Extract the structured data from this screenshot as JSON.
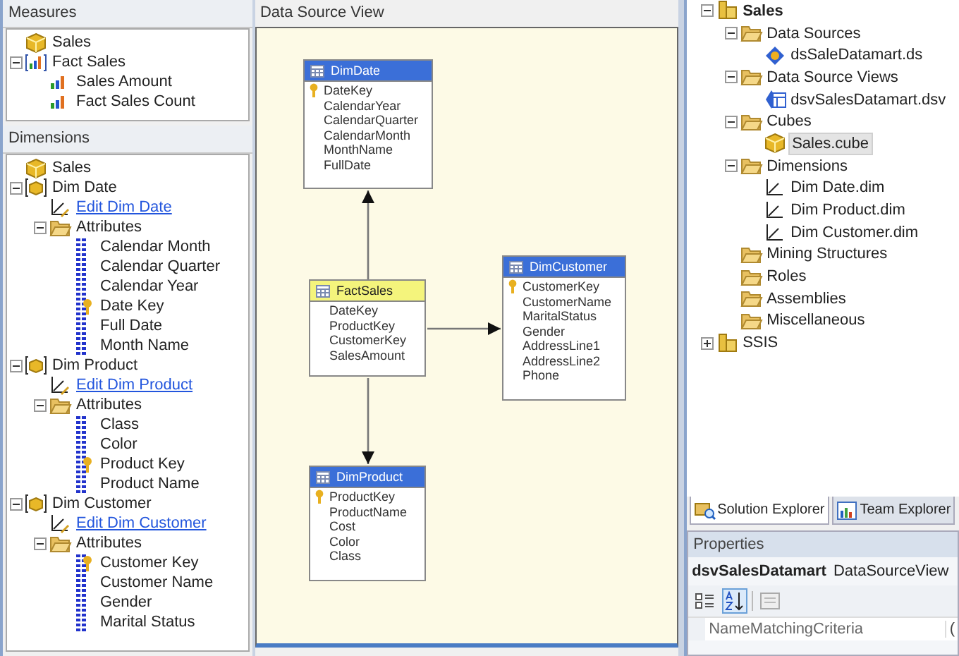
{
  "measures": {
    "title": "Measures",
    "tree": [
      {
        "label": "Sales",
        "kind": "cube"
      },
      {
        "label": "Fact Sales",
        "kind": "measure-group",
        "expanded": true,
        "children": [
          {
            "label": "Sales Amount",
            "kind": "measure"
          },
          {
            "label": "Fact Sales Count",
            "kind": "measure"
          }
        ]
      }
    ]
  },
  "dimensions": {
    "title": "Dimensions",
    "tree": [
      {
        "label": "Sales",
        "kind": "cube"
      },
      {
        "label": "Dim Date",
        "kind": "dimension",
        "expanded": true,
        "children": [
          {
            "label": "Edit Dim Date",
            "kind": "edit-link"
          },
          {
            "label": "Attributes",
            "kind": "folder",
            "expanded": true,
            "children": [
              {
                "label": "Calendar Month",
                "kind": "attribute"
              },
              {
                "label": "Calendar Quarter",
                "kind": "attribute"
              },
              {
                "label": "Calendar Year",
                "kind": "attribute"
              },
              {
                "label": "Date Key",
                "kind": "key-attribute"
              },
              {
                "label": "Full Date",
                "kind": "attribute"
              },
              {
                "label": "Month Name",
                "kind": "attribute"
              }
            ]
          }
        ]
      },
      {
        "label": "Dim Product",
        "kind": "dimension",
        "expanded": true,
        "children": [
          {
            "label": "Edit Dim Product",
            "kind": "edit-link"
          },
          {
            "label": "Attributes",
            "kind": "folder",
            "expanded": true,
            "children": [
              {
                "label": "Class",
                "kind": "attribute"
              },
              {
                "label": "Color",
                "kind": "attribute"
              },
              {
                "label": "Product Key",
                "kind": "key-attribute"
              },
              {
                "label": "Product Name",
                "kind": "attribute"
              }
            ]
          }
        ]
      },
      {
        "label": "Dim Customer",
        "kind": "dimension",
        "expanded": true,
        "children": [
          {
            "label": "Edit Dim Customer",
            "kind": "edit-link"
          },
          {
            "label": "Attributes",
            "kind": "folder",
            "expanded": true,
            "children": [
              {
                "label": "Customer Key",
                "kind": "key-attribute"
              },
              {
                "label": "Customer Name",
                "kind": "attribute"
              },
              {
                "label": "Gender",
                "kind": "attribute"
              },
              {
                "label": "Marital Status",
                "kind": "attribute"
              }
            ]
          }
        ]
      }
    ]
  },
  "data_source_view": {
    "title": "Data Source View",
    "tables": [
      {
        "name": "DimDate",
        "kind": "dimension",
        "columns": [
          {
            "name": "DateKey",
            "key": true
          },
          {
            "name": "CalendarYear",
            "key": false
          },
          {
            "name": "CalendarQuarter",
            "key": false
          },
          {
            "name": "CalendarMonth",
            "key": false
          },
          {
            "name": "MonthName",
            "key": false
          },
          {
            "name": "FullDate",
            "key": false
          }
        ]
      },
      {
        "name": "FactSales",
        "kind": "fact",
        "columns": [
          {
            "name": "DateKey",
            "key": false
          },
          {
            "name": "ProductKey",
            "key": false
          },
          {
            "name": "CustomerKey",
            "key": false
          },
          {
            "name": "SalesAmount",
            "key": false
          }
        ]
      },
      {
        "name": "DimCustomer",
        "kind": "dimension",
        "columns": [
          {
            "name": "CustomerKey",
            "key": true
          },
          {
            "name": "CustomerName",
            "key": false
          },
          {
            "name": "MaritalStatus",
            "key": false
          },
          {
            "name": "Gender",
            "key": false
          },
          {
            "name": "AddressLine1",
            "key": false
          },
          {
            "name": "AddressLine2",
            "key": false
          },
          {
            "name": "Phone",
            "key": false
          }
        ]
      },
      {
        "name": "DimProduct",
        "kind": "dimension",
        "columns": [
          {
            "name": "ProductKey",
            "key": true
          },
          {
            "name": "ProductName",
            "key": false
          },
          {
            "name": "Cost",
            "key": false
          },
          {
            "name": "Color",
            "key": false
          },
          {
            "name": "Class",
            "key": false
          }
        ]
      }
    ]
  },
  "solution_explorer": {
    "tree": [
      {
        "label": "Sales",
        "kind": "project",
        "expanded": true,
        "selected": false,
        "children": [
          {
            "label": "Data Sources",
            "kind": "folder",
            "expanded": true,
            "selected": false,
            "children": [
              {
                "label": "dsSaleDatamart.ds",
                "kind": "data-source",
                "selected": false
              }
            ]
          },
          {
            "label": "Data Source Views",
            "kind": "folder",
            "expanded": true,
            "selected": false,
            "children": [
              {
                "label": "dsvSalesDatamart.dsv",
                "kind": "dsv",
                "selected": false
              }
            ]
          },
          {
            "label": "Cubes",
            "kind": "folder",
            "expanded": true,
            "selected": false,
            "children": [
              {
                "label": "Sales.cube",
                "kind": "cube",
                "selected": true
              }
            ]
          },
          {
            "label": "Dimensions",
            "kind": "folder",
            "expanded": true,
            "selected": false,
            "children": [
              {
                "label": "Dim Date.dim",
                "kind": "dim-file",
                "selected": false
              },
              {
                "label": "Dim Product.dim",
                "kind": "dim-file",
                "selected": false
              },
              {
                "label": "Dim Customer.dim",
                "kind": "dim-file",
                "selected": false
              }
            ]
          },
          {
            "label": "Mining Structures",
            "kind": "folder",
            "selected": false
          },
          {
            "label": "Roles",
            "kind": "folder",
            "selected": false
          },
          {
            "label": "Assemblies",
            "kind": "folder",
            "selected": false
          },
          {
            "label": "Miscellaneous",
            "kind": "folder",
            "selected": false
          }
        ]
      },
      {
        "label": "SSIS",
        "kind": "project",
        "expanded": false,
        "selected": false
      }
    ]
  },
  "tabs": [
    {
      "label": "Solution Explorer",
      "selected": true
    },
    {
      "label": "Team Explorer",
      "selected": false
    }
  ],
  "properties": {
    "title": "Properties",
    "object_name": "dsvSalesDatamart",
    "object_type": "DataSourceView",
    "alphabetical": true,
    "rows": [
      {
        "name": "NameMatchingCriteria",
        "value": "("
      }
    ]
  }
}
